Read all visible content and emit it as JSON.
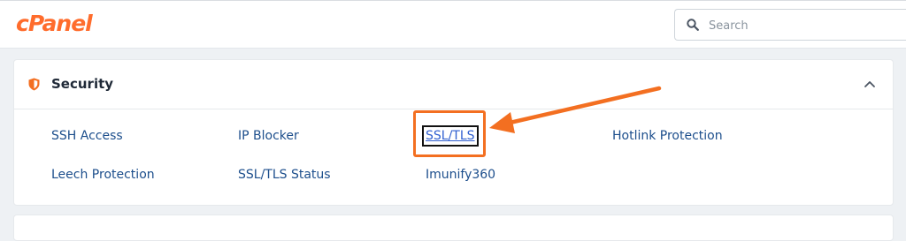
{
  "app": {
    "logo_text": "cPanel",
    "brand_color": "#ff6c2c"
  },
  "search": {
    "placeholder": "Search",
    "value": ""
  },
  "security_panel": {
    "title": "Security",
    "icon": "shield-icon",
    "collapse_icon": "chevron-up-icon",
    "items": [
      {
        "label": "SSH Access"
      },
      {
        "label": "IP Blocker"
      },
      {
        "label": "SSL/TLS"
      },
      {
        "label": "Hotlink Protection"
      },
      {
        "label": "Leech Protection"
      },
      {
        "label": "SSL/TLS Status"
      },
      {
        "label": "Imunify360"
      }
    ]
  },
  "annotation": {
    "color": "#f36f21"
  }
}
